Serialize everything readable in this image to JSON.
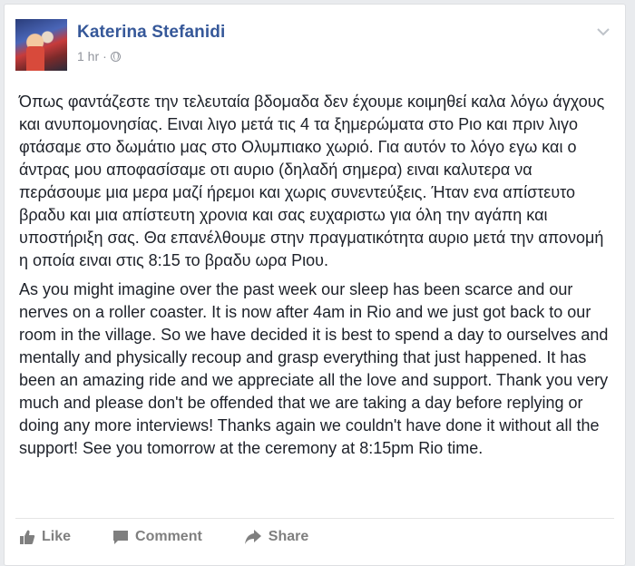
{
  "post": {
    "author": "Katerina Stefanidi",
    "time": "1 hr",
    "separator": "·",
    "privacy_icon": "globe-icon",
    "paragraphs": [
      "Όπως φαντάζεστε την τελευταία βδομαδα δεν έχουμε κοιμηθεί καλα λόγω άγχους και ανυπομονησίας. Ειναι λιγο μετά τις 4 τα ξημερώματα στο Ριο και πριν λιγο φτάσαμε στο δωμάτιο μας στο Ολυμπιακο χωριό. Για αυτόν το λόγο εγω και ο άντρας μου αποφασίσαμε οτι αυριο (δηλαδή σημερα) ειναι καλυτερα να περάσουμε μια μερα μαζί ήρεμοι και χωρις συνεντεύξεις. Ήταν ενα απίστευτο βραδυ και μια απίστευτη χρονια και σας ευχαριστω για όλη την αγάπη και υποστήριξη σας. Θα επανέλθουμε στην πραγματικότητα αυριο μετά την απονομή η οποία ειναι στις 8:15 το βραδυ ωρα Ριου.",
      "As you might imagine over the past week our sleep has been scarce and our nerves on a roller coaster. It is now after 4am in Rio and we just got back to our room in the village. So we have decided it is best to spend a day to ourselves and mentally and physically recoup and grasp everything that just happened. It has been an amazing ride and we appreciate all the love and support. Thank you very much and please don't be offended that we are taking a day before replying or doing any more interviews! Thanks again we couldn't have done it without all the support! See you tomorrow at the ceremony at 8:15pm Rio time."
    ]
  },
  "actions": {
    "like": "Like",
    "comment": "Comment",
    "share": "Share"
  },
  "colors": {
    "author": "#365899",
    "meta": "#90949c",
    "text": "#1d2129",
    "actions": "#7f7f7f"
  }
}
